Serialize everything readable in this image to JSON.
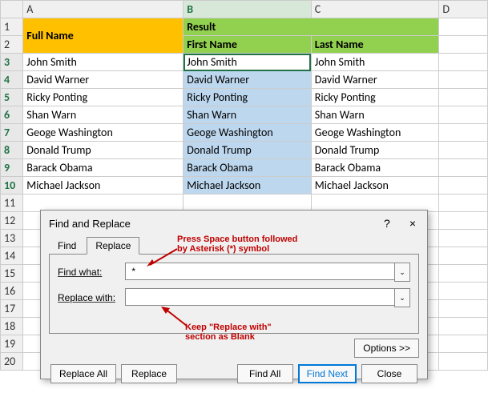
{
  "columns": [
    "A",
    "B",
    "C",
    "D"
  ],
  "header": {
    "fullname": "Full Name",
    "result": "Result",
    "firstname": "First Name",
    "lastname": "Last Name"
  },
  "rows": [
    {
      "n": "3",
      "a": "John Smith",
      "b": "John Smith",
      "c": "John Smith"
    },
    {
      "n": "4",
      "a": "David Warner",
      "b": "David Warner",
      "c": "David Warner"
    },
    {
      "n": "5",
      "a": "Ricky Ponting",
      "b": "Ricky Ponting",
      "c": "Ricky Ponting"
    },
    {
      "n": "6",
      "a": "Shan Warn",
      "b": "Shan Warn",
      "c": "Shan Warn"
    },
    {
      "n": "7",
      "a": "Geoge Washington",
      "b": "Geoge Washington",
      "c": "Geoge Washington"
    },
    {
      "n": "8",
      "a": "Donald Trump",
      "b": "Donald Trump",
      "c": "Donald Trump"
    },
    {
      "n": "9",
      "a": "Barack Obama",
      "b": "Barack Obama",
      "c": "Barack Obama"
    },
    {
      "n": "10",
      "a": "Michael Jackson",
      "b": "Michael Jackson",
      "c": "Michael Jackson"
    }
  ],
  "emptyRows": [
    "11",
    "12",
    "13",
    "14",
    "15",
    "16",
    "17",
    "18",
    "19",
    "20"
  ],
  "dialog": {
    "title": "Find and Replace",
    "help": "?",
    "close": "×",
    "tabs": {
      "find": "Find",
      "replace": "Replace"
    },
    "findLabel": "Find what:",
    "findValue": " *",
    "replaceLabel": "Replace with:",
    "replaceValue": "",
    "options": "Options >>",
    "buttons": {
      "replaceAll": "Replace All",
      "replace": "Replace",
      "findAll": "Find All",
      "findNext": "Find Next",
      "close": "Close"
    }
  },
  "annotations": {
    "a1": "Press Space button followed\nby Asterisk (*) symbol",
    "a2": "Keep \"Replace with\"\nsection as Blank"
  }
}
